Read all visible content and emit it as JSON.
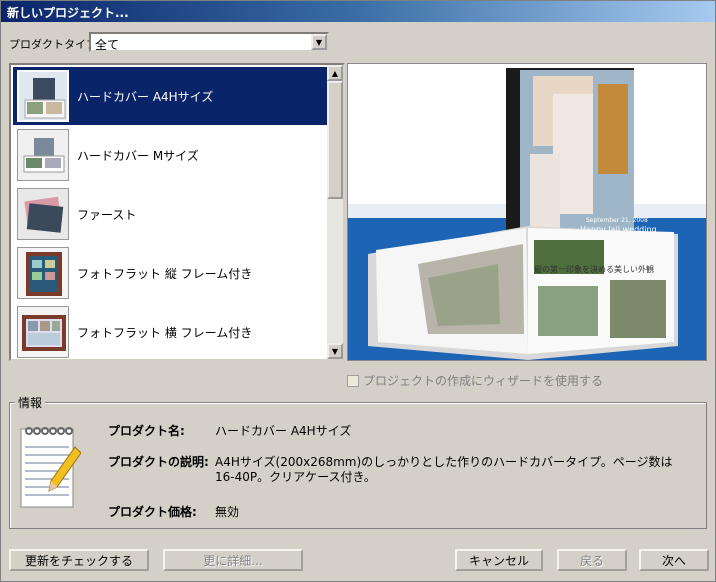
{
  "window": {
    "title": "新しいプロジェクト..."
  },
  "product_type": {
    "label": "プロダクトタイプ:",
    "value": "全て"
  },
  "list": {
    "items": [
      {
        "label": "ハードカバー  A4Hサイズ",
        "selected": true
      },
      {
        "label": "ハードカバー  Mサイズ",
        "selected": false
      },
      {
        "label": "ファースト",
        "selected": false
      },
      {
        "label": "フォトフラット  縦  フレーム付き",
        "selected": false
      },
      {
        "label": "フォトフラット  横  フレーム付き",
        "selected": false
      }
    ]
  },
  "preview": {
    "cover_text_1": "September 21, 2008",
    "cover_text_2": "Happy Jail wedding",
    "page_text": "最の第一印象を決める美しい外観"
  },
  "wizard_checkbox": {
    "label": "プロジェクトの作成にウィザードを使用する",
    "checked": false
  },
  "info": {
    "legend": "情報",
    "product_name_label": "プロダクト名:",
    "product_name_value": "ハードカバー  A4Hサイズ",
    "description_label": "プロダクトの説明:",
    "description_line1": "A4Hサイズ(200x268mm)のしっかりとした作りのハードカバータイプ。ページ数は",
    "description_line2": "16-40P。クリアケース付き。",
    "price_label": "プロダクト価格:",
    "price_value": "無効"
  },
  "buttons": {
    "check_updates": "更新をチェックする",
    "more_details": "更に詳細...",
    "cancel": "キャンセル",
    "back": "戻る",
    "next": "次へ"
  },
  "colors": {
    "selection": "#0a246a",
    "face": "#d4d0c8",
    "preview_bg": "#1e64b4"
  }
}
